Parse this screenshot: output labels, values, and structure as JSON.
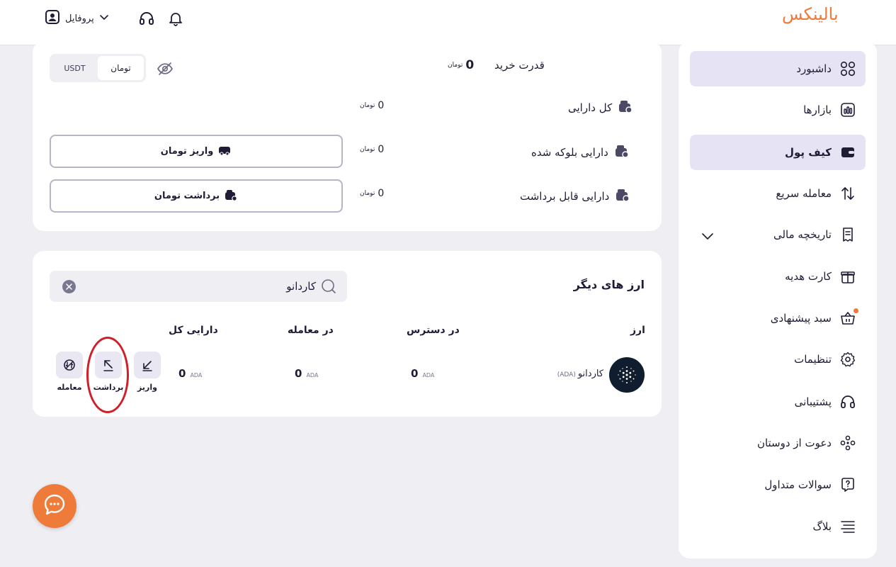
{
  "brand": {
    "name": "بالینکس",
    "color": "#ee7b3a"
  },
  "header": {
    "profile_label": "پروفایل",
    "icons": [
      "profile-icon",
      "chevron-down-icon",
      "headset-icon",
      "bell-icon"
    ]
  },
  "sidebar": {
    "items": [
      {
        "label": "داشبورد",
        "icon": "grid-icon",
        "active": true
      },
      {
        "label": "بازارها",
        "icon": "chart-icon",
        "active": false
      },
      {
        "label": "کیف پول",
        "icon": "wallet-icon",
        "active": true
      },
      {
        "label": "معامله سریع",
        "icon": "swap-icon",
        "active": false
      },
      {
        "label": "تاریخچه مالی",
        "icon": "receipt-icon",
        "active": false
      },
      {
        "label": "کارت هدیه",
        "icon": "gift-icon",
        "active": false
      },
      {
        "label": "سبد پیشنهادی",
        "icon": "basket-icon",
        "active": false
      },
      {
        "label": "تنظیمات",
        "icon": "gear-icon",
        "active": false
      },
      {
        "label": "پشتیبانی",
        "icon": "headset-icon",
        "active": false
      },
      {
        "label": "دعوت از دوستان",
        "icon": "people-icon",
        "active": false
      },
      {
        "label": "سوالات متداول",
        "icon": "question-icon",
        "active": false
      },
      {
        "label": "بلاگ",
        "icon": "lines-icon",
        "active": false
      }
    ]
  },
  "wallet": {
    "currency_toggle": {
      "options": [
        "USDT",
        "تومان"
      ],
      "selected": "تومان"
    },
    "buying_power": {
      "label": "قدرت خرید",
      "value": "0",
      "unit": "تومان"
    },
    "rows": [
      {
        "label": "کل دارایی",
        "value": "0",
        "unit": "تومان"
      },
      {
        "label": "دارایی بلوکه شده",
        "value": "0",
        "unit": "تومان"
      },
      {
        "label": "دارایی قابل برداشت",
        "value": "0",
        "unit": "تومان"
      }
    ],
    "deposit_button": "واریز تومان",
    "withdraw_button": "برداشت تومان"
  },
  "other_currencies": {
    "title": "ارز های دیگر",
    "search_value": "کاردانو",
    "columns": [
      "ارز",
      "در دسترس",
      "در معامله",
      "دارایی کل"
    ],
    "rows": [
      {
        "name": "کاردانو",
        "symbol": "(ADA)",
        "available": "0",
        "in_trade": "0",
        "total": "0",
        "unit": "ADA",
        "actions": [
          "واریز",
          "برداشت",
          "معامله"
        ]
      }
    ]
  },
  "annotation_color": "#d01f2a"
}
